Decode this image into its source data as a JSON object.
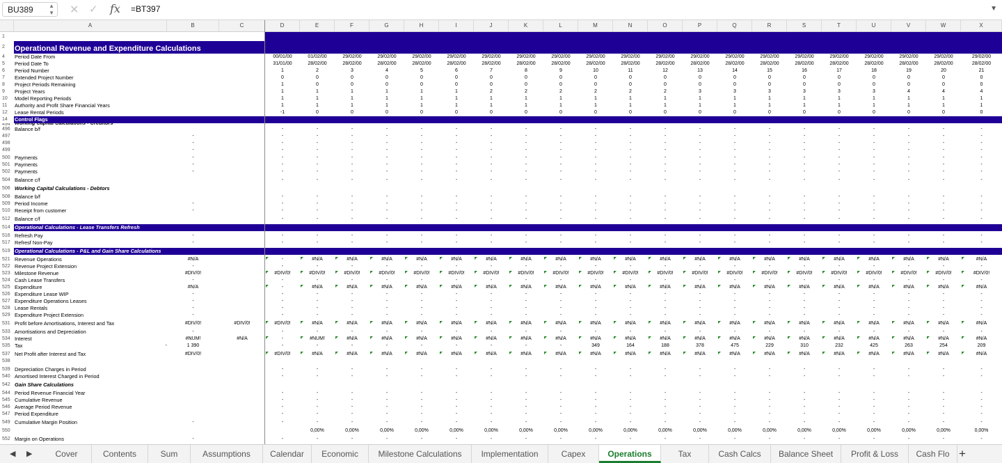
{
  "formula_bar": {
    "name_box": "BU389",
    "cancel_icon": "close-icon",
    "enter_icon": "check-icon",
    "fx_label": "fx",
    "formula": "=BT397"
  },
  "columns": [
    "A",
    "B",
    "C",
    "D",
    "E",
    "F",
    "G",
    "H",
    "I",
    "J",
    "K",
    "L",
    "M",
    "N",
    "O",
    "P",
    "Q",
    "R",
    "S",
    "T",
    "U",
    "V",
    "W",
    "X"
  ],
  "title": "Operational Revenue and Expenditure Calculations",
  "header_rows": [
    {
      "n": "1",
      "label": ""
    },
    {
      "n": "2",
      "label": ""
    },
    {
      "n": "4",
      "label": "Period Date From",
      "vals": [
        "00/01/00",
        "01/02/00",
        "29/02/00",
        "29/02/00",
        "29/02/00",
        "29/02/00",
        "29/02/00",
        "29/02/00",
        "29/02/00",
        "29/02/00",
        "29/02/00",
        "29/02/00",
        "29/02/00",
        "29/02/00",
        "29/02/00",
        "29/02/00",
        "29/02/00",
        "29/02/00",
        "29/02/00",
        "29/02/00",
        "29/02/00"
      ]
    },
    {
      "n": "5",
      "label": "Period Date To",
      "vals": [
        "31/01/00",
        "28/02/00",
        "28/02/00",
        "28/02/00",
        "28/02/00",
        "28/02/00",
        "28/02/00",
        "28/02/00",
        "28/02/00",
        "28/02/00",
        "28/02/00",
        "28/02/00",
        "28/02/00",
        "28/02/00",
        "28/02/00",
        "28/02/00",
        "28/02/00",
        "28/02/00",
        "28/02/00",
        "28/02/00",
        "28/02/00"
      ]
    },
    {
      "n": "6",
      "label": "Period Number",
      "vals": [
        "1",
        "2",
        "3",
        "4",
        "5",
        "6",
        "7",
        "8",
        "9",
        "10",
        "11",
        "12",
        "13",
        "14",
        "15",
        "16",
        "17",
        "18",
        "19",
        "20",
        "21"
      ]
    },
    {
      "n": "7",
      "label": "Extended Project Number",
      "vals": [
        "0",
        "0",
        "0",
        "0",
        "0",
        "0",
        "0",
        "0",
        "0",
        "0",
        "0",
        "0",
        "0",
        "0",
        "0",
        "0",
        "0",
        "0",
        "0",
        "0",
        "0"
      ]
    },
    {
      "n": "8",
      "label": "Project Periods Remaining",
      "vals": [
        "1",
        "0",
        "0",
        "0",
        "0",
        "0",
        "0",
        "0",
        "0",
        "0",
        "0",
        "0",
        "0",
        "0",
        "0",
        "0",
        "0",
        "0",
        "0",
        "0",
        "0"
      ]
    },
    {
      "n": "9",
      "label": "Project Years",
      "vals": [
        "1",
        "1",
        "1",
        "1",
        "1",
        "1",
        "2",
        "2",
        "2",
        "2",
        "2",
        "2",
        "3",
        "3",
        "3",
        "3",
        "3",
        "3",
        "4",
        "4",
        "4"
      ]
    },
    {
      "n": "10",
      "label": "Model Reporting Periods",
      "vals": [
        "1",
        "1",
        "1",
        "1",
        "1",
        "1",
        "1",
        "1",
        "1",
        "1",
        "1",
        "1",
        "1",
        "1",
        "1",
        "1",
        "1",
        "1",
        "1",
        "1",
        "1"
      ]
    },
    {
      "n": "11",
      "label": "Authority and Profit Share Financial Years",
      "vals": [
        "1",
        "1",
        "1",
        "1",
        "1",
        "1",
        "1",
        "1",
        "1",
        "1",
        "1",
        "1",
        "1",
        "1",
        "1",
        "1",
        "1",
        "1",
        "1",
        "1",
        "1"
      ]
    },
    {
      "n": "12",
      "label": "Lease Rental Periods",
      "vals": [
        "-1",
        "0",
        "0",
        "0",
        "0",
        "0",
        "0",
        "0",
        "0",
        "0",
        "0",
        "0",
        "0",
        "0",
        "0",
        "0",
        "0",
        "0",
        "0",
        "0",
        "0"
      ]
    }
  ],
  "control_flags": {
    "n": "14",
    "label": "Control Flags"
  },
  "section_cut": {
    "n": "494",
    "label": "Working Capital Calculations - Creditors"
  },
  "rows": [
    {
      "n": "496",
      "label": "Balance b/f",
      "b": "",
      "c": "",
      "d": "dash"
    },
    {
      "n": "497",
      "label": "",
      "b": "-",
      "d": "dash"
    },
    {
      "n": "498",
      "label": "",
      "b": "-",
      "d": "dash"
    },
    {
      "n": "499",
      "label": "",
      "b": "-",
      "d": "dash"
    },
    {
      "n": "500",
      "label": "Payments",
      "b": "-",
      "d": "dash"
    },
    {
      "n": "501",
      "label": "Payments",
      "b": "-",
      "d": "dash"
    },
    {
      "n": "502",
      "label": "Payments",
      "b": "-",
      "d": "dash"
    },
    {
      "n": "504",
      "label": "Balance c/f",
      "d": "dash"
    },
    {
      "n": "506",
      "label": "Working Capital Calculations - Debtors",
      "style": "bi"
    },
    {
      "n": "508",
      "label": "Balance b/f",
      "d": "dash"
    },
    {
      "n": "509",
      "label": "Period Income",
      "b": "-",
      "d": "dash"
    },
    {
      "n": "510",
      "label": "Receipt from customer",
      "b": "-",
      "d": "dash"
    },
    {
      "n": "512",
      "label": "Balance c/f",
      "d": "dash"
    },
    {
      "n": "514",
      "label": "Operational Calculations - Lease Transfers Refresh",
      "style": "bar"
    },
    {
      "n": "516",
      "label": "Refresh Pay",
      "b": "-",
      "d": "dash"
    },
    {
      "n": "517",
      "label": "Refresf Non-Pay",
      "b": "-",
      "d": "dash"
    },
    {
      "n": "519",
      "label": "Operational Calculations - P&L and Gain Share Calculations",
      "style": "bar"
    },
    {
      "n": "521",
      "label": "Revenue Operations",
      "b": "#N/A",
      "d": "na"
    },
    {
      "n": "522",
      "label": "Revenue Project Extension",
      "b": "-",
      "d": "dash"
    },
    {
      "n": "523",
      "label": "Milestone Revenue",
      "b": "#DIV/0!",
      "d": "div"
    },
    {
      "n": "524",
      "label": "Cash Lease Transfers",
      "b": "-",
      "d": "dash"
    },
    {
      "n": "525",
      "label": "Expenditure",
      "b": "#N/A",
      "d": "na"
    },
    {
      "n": "526",
      "label": "Expenditure Lease WIP",
      "b": "-",
      "d": "dash"
    },
    {
      "n": "527",
      "label": "Expenditure Operations Leases",
      "b": "-",
      "d": "dash"
    },
    {
      "n": "528",
      "label": "Lease Rentals",
      "b": "-",
      "d": "dash"
    },
    {
      "n": "529",
      "label": "Expenditure Project Extension",
      "b": "-",
      "d": "dash"
    },
    {
      "n": "531",
      "label": "Profit before Amortisations, Interest and Tax",
      "b": "#DIV/0!",
      "c": "#DIV/0!",
      "d": "profit"
    },
    {
      "n": "533",
      "label": "Amortisations and Depreciation",
      "b": "-",
      "d": "dash"
    },
    {
      "n": "534",
      "label": "Interest",
      "b": "#NUM!",
      "c": "#N/A",
      "d": "interest"
    },
    {
      "n": "535",
      "label": "Tax",
      "a2": "-",
      "b": "1 390",
      "d": "tax"
    },
    {
      "n": "537",
      "label": "Net Profit after Interest and Tax",
      "b": "#DIV/0!",
      "d": "profit"
    },
    {
      "n": "538",
      "label": "",
      "d": "none"
    },
    {
      "n": "539",
      "label": "Depreciation Charges in Period",
      "d": "dash"
    },
    {
      "n": "540",
      "label": "Amortised Interest Charged in Period",
      "d": "dash"
    },
    {
      "n": "542",
      "label": "Gain Share Calculations",
      "style": "bi"
    },
    {
      "n": "544",
      "label": "Period Revenue Financial Year",
      "d": "dash"
    },
    {
      "n": "545",
      "label": "Cumulative Revenue",
      "d": "dash"
    },
    {
      "n": "546",
      "label": "Average Period Revenue",
      "d": "dash"
    },
    {
      "n": "547",
      "label": "Period Expenditure",
      "d": "dash"
    },
    {
      "n": "549",
      "label": "Cumulative Margin Position",
      "b": "-",
      "d": "dash"
    },
    {
      "n": "550",
      "label": "",
      "d": "pct"
    },
    {
      "n": "552",
      "label": "Margin on Operations",
      "b": "-",
      "d": "dash"
    }
  ],
  "tax_values": [
    "-",
    "-",
    "-",
    "-",
    "-",
    "-",
    "-",
    "-",
    "-",
    "349",
    "164",
    "188",
    "378",
    "475",
    "229",
    "310",
    "232",
    "425",
    "263",
    "254",
    "209"
  ],
  "sheet_tabs": [
    "Cover",
    "Contents",
    "Sum",
    "Assumptions",
    "Calendar",
    "Economic",
    "Milestone Calculations",
    "Implementation",
    "Capex",
    "Operations",
    "Tax",
    "Cash Calcs",
    "Balance Sheet",
    "Profit & Loss",
    "Cash Flo"
  ],
  "active_tab": "Operations",
  "error_values": {
    "na": "#N/A",
    "div": "#DIV/0!",
    "num": "#NUM!",
    "pct": "0,00%",
    "dash": "-"
  }
}
